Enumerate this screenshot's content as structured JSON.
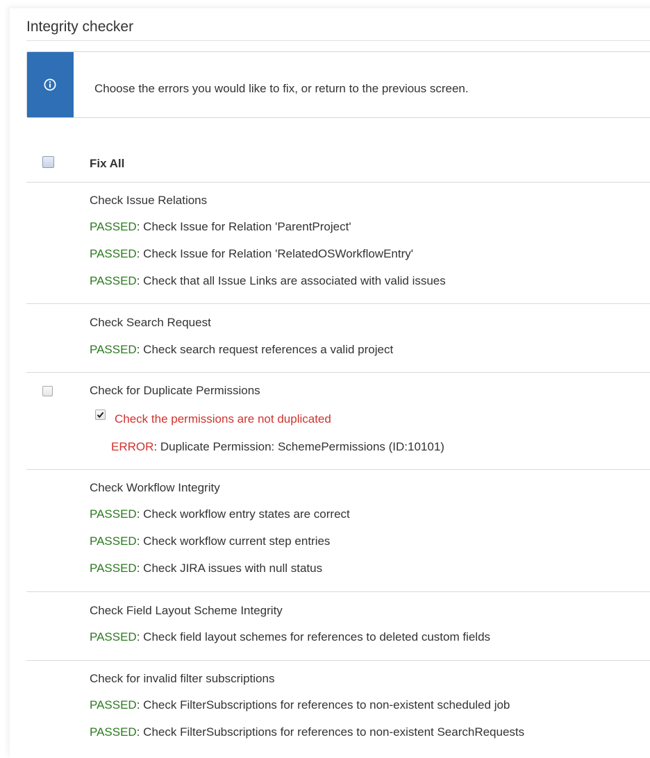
{
  "page": {
    "title": "Integrity checker"
  },
  "info": {
    "message": "Choose the errors you would like to fix, or return to the previous screen."
  },
  "fix_all": {
    "label": "Fix All",
    "checked": false
  },
  "groups": [
    {
      "title": "Check Issue Relations",
      "results": [
        {
          "status": "PASSED",
          "text": ": Check Issue for Relation 'ParentProject'"
        },
        {
          "status": "PASSED",
          "text": ": Check Issue for Relation 'RelatedOSWorkflowEntry'"
        },
        {
          "status": "PASSED",
          "text": ": Check that all Issue Links are associated with valid issues"
        }
      ]
    },
    {
      "title": "Check Search Request",
      "results": [
        {
          "status": "PASSED",
          "text": ": Check search request references a valid project"
        }
      ]
    },
    {
      "title": "Check for Duplicate Permissions",
      "checked": false,
      "subcheck": {
        "label": "Check the permissions are not duplicated",
        "checked": true
      },
      "results": [
        {
          "status": "ERROR",
          "text": ": Duplicate Permission: SchemePermissions (ID:10101)"
        }
      ]
    },
    {
      "title": "Check Workflow Integrity",
      "results": [
        {
          "status": "PASSED",
          "text": ": Check workflow entry states are correct"
        },
        {
          "status": "PASSED",
          "text": ": Check workflow current step entries"
        },
        {
          "status": "PASSED",
          "text": ": Check JIRA issues with null status"
        }
      ]
    },
    {
      "title": "Check Field Layout Scheme Integrity",
      "results": [
        {
          "status": "PASSED",
          "text": ": Check field layout schemes for references to deleted custom fields"
        }
      ]
    },
    {
      "title": "Check for invalid filter subscriptions",
      "results": [
        {
          "status": "PASSED",
          "text": ": Check FilterSubscriptions for references to non-existent scheduled job"
        },
        {
          "status": "PASSED",
          "text": ": Check FilterSubscriptions for references to non-existent SearchRequests"
        }
      ]
    }
  ],
  "colors": {
    "passed": "#2b7a1f",
    "error": "#d0312d",
    "info_accent": "#2f6fb5"
  },
  "icons": {
    "info": "info-circle-icon",
    "checkmark": "checkmark-icon"
  }
}
